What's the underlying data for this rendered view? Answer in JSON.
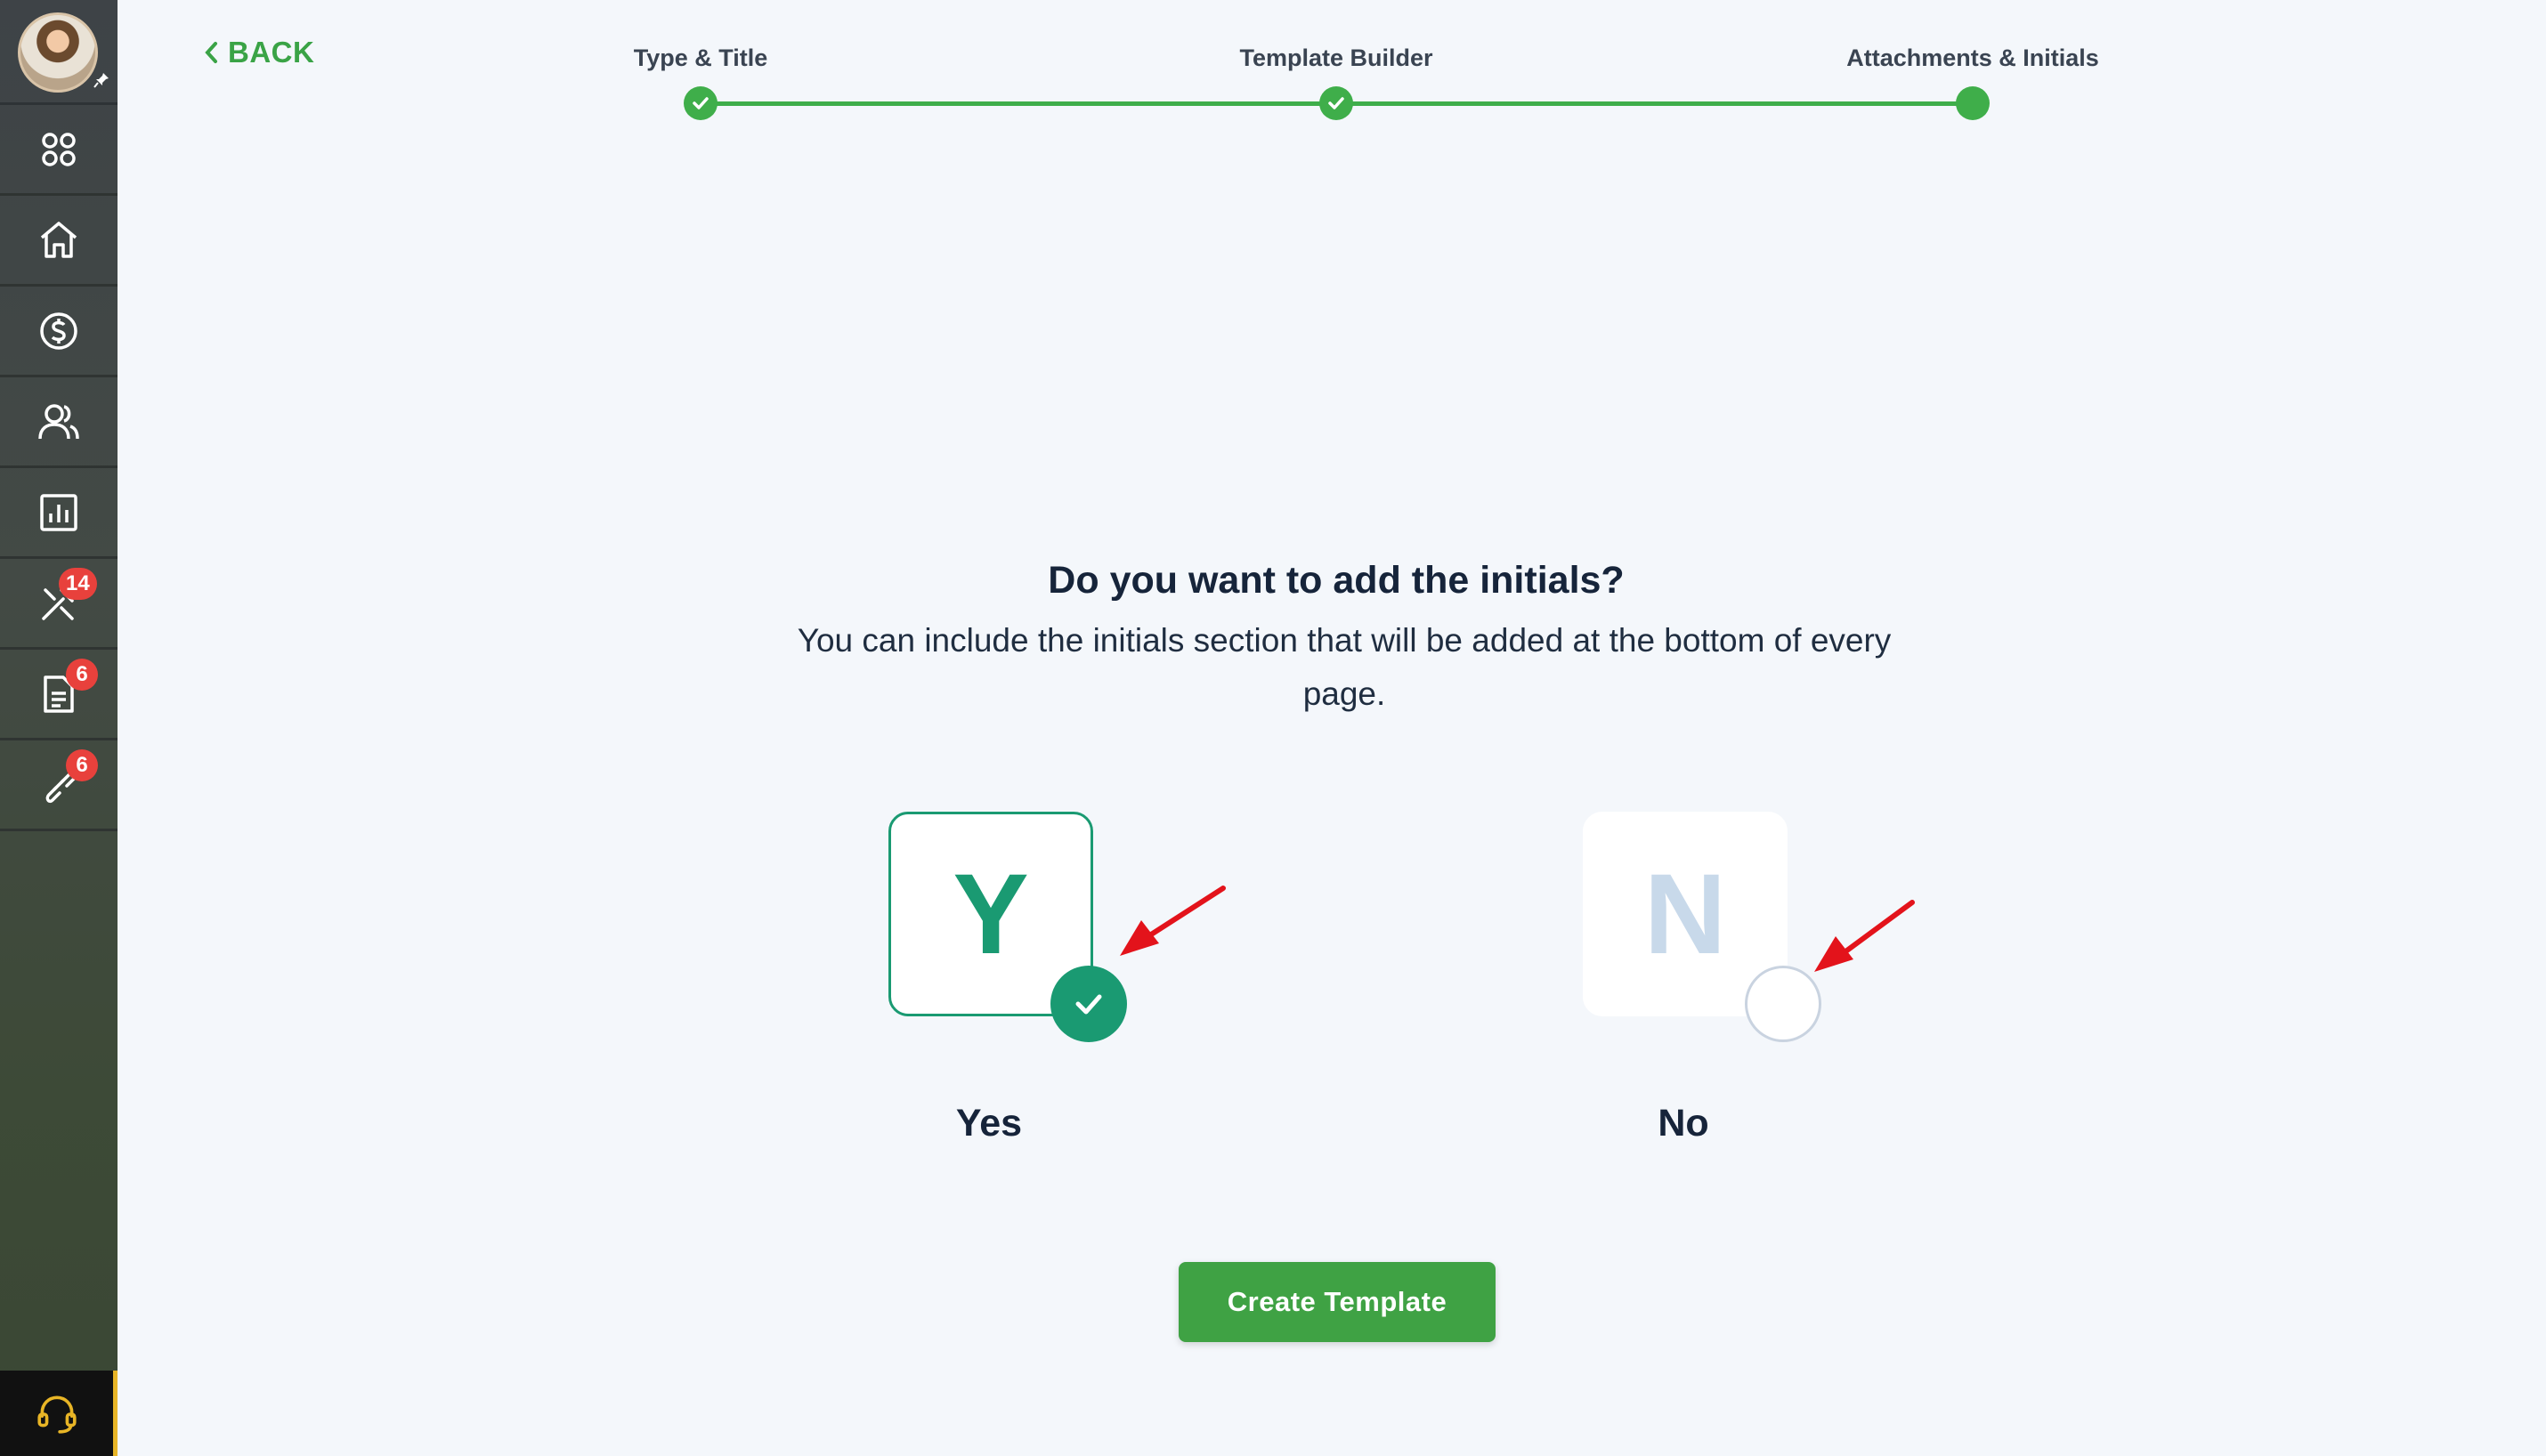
{
  "sidebar": {
    "items": [
      {
        "icon": "apps-grid-icon",
        "badge": ""
      },
      {
        "icon": "home-icon",
        "badge": ""
      },
      {
        "icon": "dollar-circle-icon",
        "badge": ""
      },
      {
        "icon": "users-icon",
        "badge": ""
      },
      {
        "icon": "reports-chart-icon",
        "badge": ""
      },
      {
        "icon": "tools-icon",
        "badge": "14"
      },
      {
        "icon": "document-icon",
        "badge": "6"
      },
      {
        "icon": "link-icon",
        "badge": "6"
      }
    ],
    "support_icon": "headset-icon"
  },
  "header": {
    "back_label": "BACK"
  },
  "stepper": {
    "steps": [
      {
        "label": "Type & Title",
        "status": "complete"
      },
      {
        "label": "Template Builder",
        "status": "complete"
      },
      {
        "label": "Attachments & Initials",
        "status": "current"
      }
    ],
    "color": "#3fae4a"
  },
  "main": {
    "question": "Do you want to add the initials?",
    "subtitle": "You can include the initials section that will be added at the bottom of every page.",
    "options": [
      {
        "letter": "Y",
        "label": "Yes",
        "selected": true
      },
      {
        "letter": "N",
        "label": "No",
        "selected": false
      }
    ],
    "create_button": "Create Template"
  },
  "colors": {
    "accent_green": "#3fa244",
    "selected_teal": "#1a9a72",
    "badge_red": "#e8413c",
    "annotation_arrow": "#e3131b"
  }
}
